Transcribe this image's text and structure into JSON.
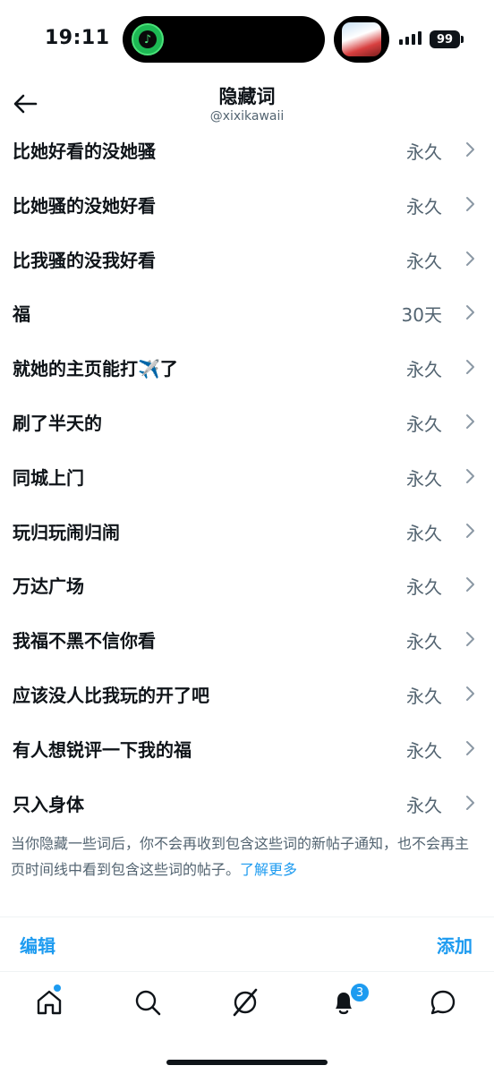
{
  "status": {
    "time": "19:11",
    "battery": "99",
    "island_app_icon": "music-note-icon",
    "island_right_icon": "game-thumbnail"
  },
  "header": {
    "title": "隐藏词",
    "subtitle": "@xixikawaii",
    "back_icon": "back-arrow-icon"
  },
  "muted_words": [
    {
      "word": "比她好看的没她骚",
      "duration": "永久"
    },
    {
      "word": "比她骚的没她好看",
      "duration": "永久"
    },
    {
      "word": "比我骚的没我好看",
      "duration": "永久"
    },
    {
      "word": "福",
      "duration": "30天"
    },
    {
      "word": "就她的主页能打✈️了",
      "duration": "永久"
    },
    {
      "word": "刷了半天的",
      "duration": "永久"
    },
    {
      "word": "同城上门",
      "duration": "永久"
    },
    {
      "word": "玩归玩闹归闹",
      "duration": "永久"
    },
    {
      "word": "万达广场",
      "duration": "永久"
    },
    {
      "word": "我福不黑不信你看",
      "duration": "永久"
    },
    {
      "word": "应该没人比我玩的开了吧",
      "duration": "永久"
    },
    {
      "word": "有人想锐评一下我的福",
      "duration": "永久"
    },
    {
      "word": "只入身体",
      "duration": "永久"
    }
  ],
  "note": {
    "text": "当你隐藏一些词后，你不会再收到包含这些词的新帖子通知，也不会再主页时间线中看到包含这些词的帖子。",
    "link": "了解更多"
  },
  "actions": {
    "edit": "编辑",
    "add": "添加"
  },
  "tabbar": {
    "notifications_badge": "3",
    "icons": [
      "home-icon",
      "search-icon",
      "grok-icon",
      "bell-icon",
      "messages-icon"
    ]
  },
  "colors": {
    "accent": "#1d9bf0",
    "text": "#0f1419",
    "secondary": "#536471"
  }
}
